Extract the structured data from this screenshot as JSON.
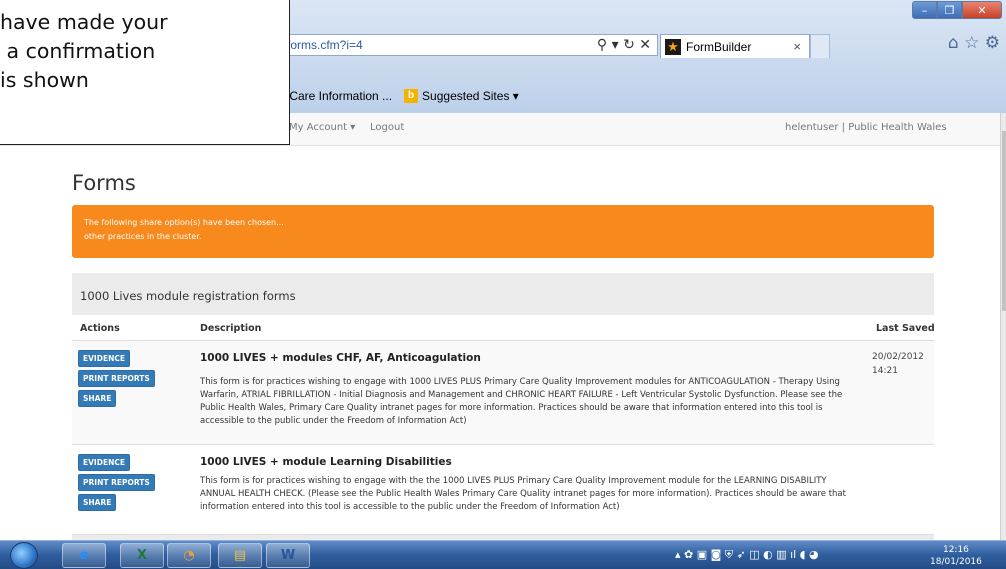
{
  "callout": {
    "line1": "have made your",
    "line2": " a confirmation",
    "line3": "is shown"
  },
  "browser": {
    "address": "forms.cfm?i=4",
    "tab_title": "FormBuilder",
    "tab_close": "×",
    "addr_icons": "⚲ ▾ ↻ ✕",
    "favorites": [
      {
        "label": "y Care Information ..."
      },
      {
        "label": "Suggested Sites ▾"
      }
    ],
    "window_controls": {
      "minimize": "–",
      "maximize": "❐",
      "close": "✕"
    },
    "toolbar_icons": "⌂ ☆ ⚙"
  },
  "navbar": {
    "account": "My Account ▾",
    "logout": "Logout",
    "user": "helentuser | Public Health Wales"
  },
  "page": {
    "title": "Forms",
    "alert_line1": "The following share option(s) have been chosen...",
    "alert_line2": "other practices in the cluster.",
    "panel_title": "1000 Lives module registration forms",
    "columns": {
      "actions": "Actions",
      "description": "Description",
      "last_saved": "Last Saved"
    },
    "rows": [
      {
        "buttons": [
          "EVIDENCE",
          "PRINT REPORTS",
          "SHARE"
        ],
        "title": "1000 LIVES + modules CHF, AF, Anticoagulation",
        "description": "This form is for practices wishing to engage with 1000 LIVES PLUS Primary Care Quality Improvement modules for ANTICOAGULATION - Therapy Using Warfarin, ATRIAL FIBRILLATION - Initial Diagnosis and Management and CHRONIC HEART FAILURE - Left Ventricular Systolic Dysfunction. Please see the Public Health Wales, Primary Care Quality intranet pages for more information. Practices should be aware that information entered into this tool is accessible to the public under the Freedom of Information Act)",
        "date": "20/02/2012",
        "time": "14:21"
      },
      {
        "buttons": [
          "EVIDENCE",
          "PRINT REPORTS",
          "SHARE"
        ],
        "title": "1000 LIVES + module Learning Disabilities",
        "description": "This form is for practices wishing to engage with the the 1000 LIVES PLUS Primary Care Quality Improvement module for the LEARNING DISABILITY ANNUAL HEALTH CHECK. (Please see the Public Health Wales Primary Care Quality intranet pages for more information). Practices should be aware that information entered into this tool is accessible to the public under the Freedom of Information Act)",
        "date": "",
        "time": ""
      }
    ]
  },
  "taskbar": {
    "apps": [
      {
        "name": "ie",
        "glyph": "e",
        "color": "#1e90ff"
      },
      {
        "name": "excel",
        "glyph": "X",
        "color": "#1f7a3a"
      },
      {
        "name": "outlook",
        "glyph": "◔",
        "color": "#f0a030"
      },
      {
        "name": "explorer",
        "glyph": "▤",
        "color": "#e8c34a"
      },
      {
        "name": "word",
        "glyph": "W",
        "color": "#2b579a"
      }
    ],
    "tray_icons": "▴ ✿ ▣ ◙ ⛨ ➶ ◫ ◐ ▥ ıl ◖ ◕",
    "time": "12:16",
    "date": "18/01/2016"
  }
}
